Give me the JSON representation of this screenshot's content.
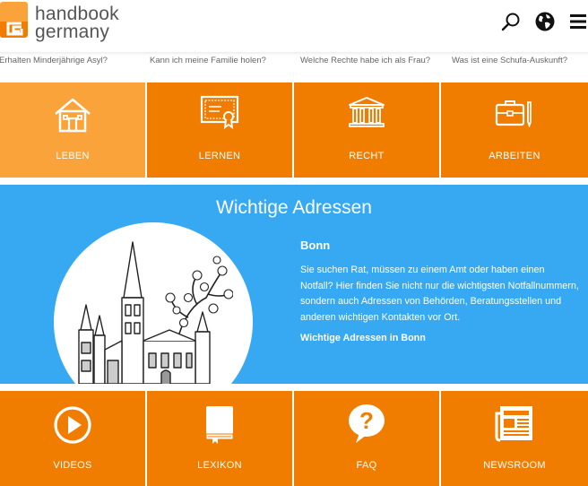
{
  "brand": {
    "line1": "handbook",
    "line2": "germany",
    "accent": "#f07d00"
  },
  "header_icons": [
    "search-icon",
    "globe-icon",
    "menu-icon"
  ],
  "questions": [
    "Erhalten Minderjährige Asyl?",
    "Kann ich meine Familie holen?",
    "Welche Rechte habe ich als Frau?",
    "Was ist eine Schufa-Auskunft?"
  ],
  "top_tiles": [
    {
      "label": "LEBEN",
      "icon": "house-icon"
    },
    {
      "label": "LERNEN",
      "icon": "certificate-icon"
    },
    {
      "label": "RECHT",
      "icon": "courthouse-icon"
    },
    {
      "label": "ARBEITEN",
      "icon": "briefcase-icon"
    }
  ],
  "banner": {
    "title": "Wichtige Adressen",
    "city": "Bonn",
    "description": "Sie suchen Rat, müssen zu einem Amt oder haben einen Notfall? Hier finden Sie nicht nur die wichtigsten Notfallnummern, sondern auch Adressen von Behörden, Beratungsstellen und anderen wichtigen Kontakten vor Ort.",
    "link": "Wichtige Adressen in Bonn",
    "color": "#37a8f2"
  },
  "bottom_tiles": [
    {
      "label": "VIDEOS",
      "icon": "play-icon"
    },
    {
      "label": "LEXIKON",
      "icon": "book-icon"
    },
    {
      "label": "FAQ",
      "icon": "question-bubble-icon"
    },
    {
      "label": "NEWSROOM",
      "icon": "newspaper-icon"
    }
  ]
}
